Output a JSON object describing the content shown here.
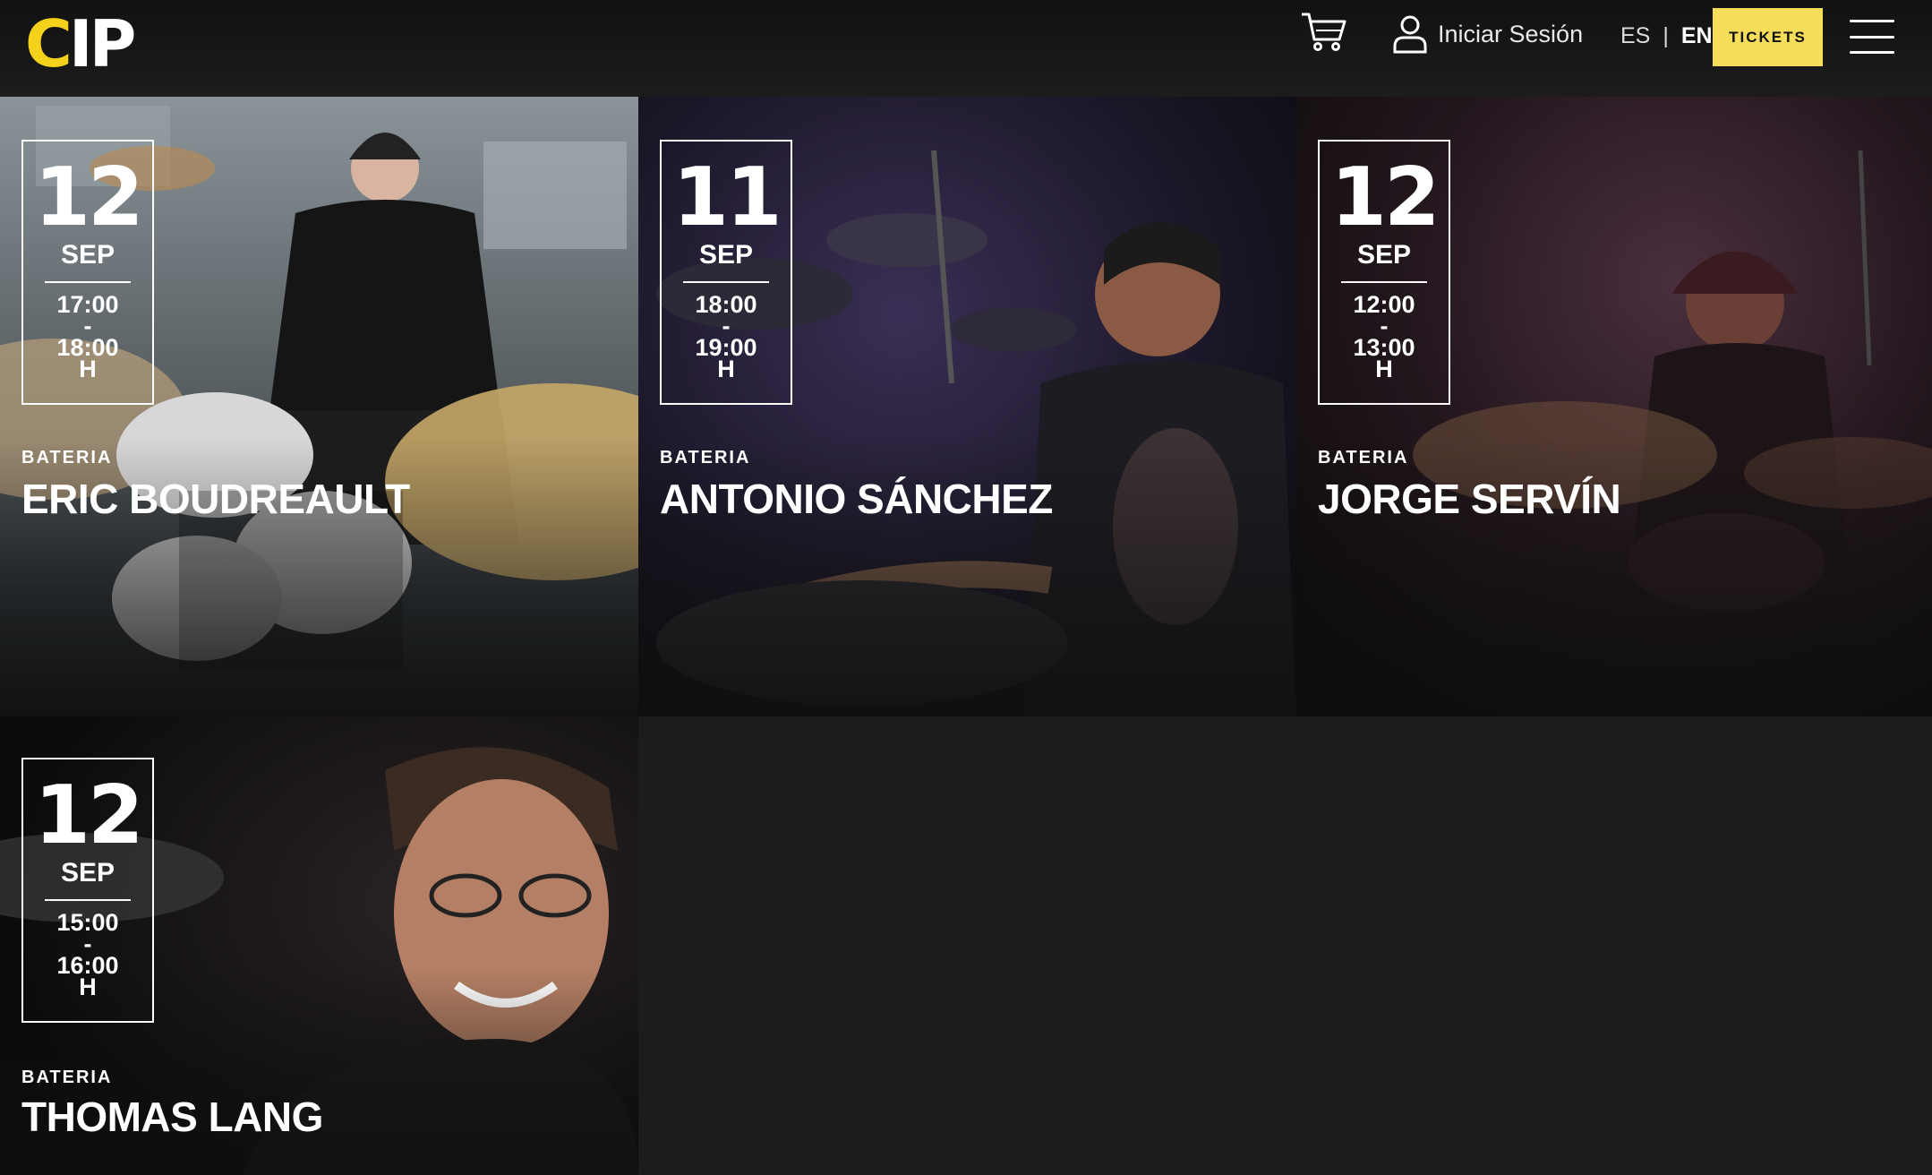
{
  "header": {
    "logo_text": "CIP",
    "login_label": "Iniciar Sesión",
    "lang_es": "ES",
    "lang_sep": "|",
    "lang_en": "EN",
    "tickets_label": "TICKETS",
    "brand_yellow": "#f6de5a"
  },
  "cards": [
    {
      "day": "12",
      "month": "SEP",
      "time_start": "17:00",
      "dash": "-",
      "time_end": "18:00",
      "unit": "H",
      "category": "BATERIA",
      "artist": "ERIC BOUDREAULT"
    },
    {
      "day": "11",
      "month": "SEP",
      "time_start": "18:00",
      "dash": "-",
      "time_end": "19:00",
      "unit": "H",
      "category": "BATERIA",
      "artist": "ANTONIO SÁNCHEZ"
    },
    {
      "day": "12",
      "month": "SEP",
      "time_start": "12:00",
      "dash": "-",
      "time_end": "13:00",
      "unit": "H",
      "category": "BATERIA",
      "artist": "JORGE SERVÍN"
    },
    {
      "day": "12",
      "month": "SEP",
      "time_start": "15:00",
      "dash": "-",
      "time_end": "16:00",
      "unit": "H",
      "category": "BATERIA",
      "artist": "THOMAS LANG"
    }
  ]
}
